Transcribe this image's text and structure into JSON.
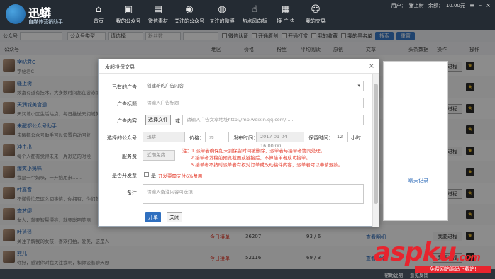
{
  "app": {
    "logo_name": "迅蟒",
    "logo_sub": "自媒体营销助手"
  },
  "nav": [
    {
      "label": "首页",
      "icon": "home-icon"
    },
    {
      "label": "我的公众号",
      "icon": "account-icon"
    },
    {
      "label": "微信素材",
      "icon": "folder-icon"
    },
    {
      "label": "关注的公众号",
      "icon": "wechat-icon"
    },
    {
      "label": "关注的微博",
      "icon": "weibo-icon"
    },
    {
      "label": "热点风向标",
      "icon": "thumbs-up-icon"
    },
    {
      "label": "接 广 告",
      "icon": "ad-icon"
    },
    {
      "label": "我的交易",
      "icon": "user-icon"
    }
  ],
  "userbar": {
    "user_label": "用户：",
    "user_name": "猪上树",
    "balance_label": "余额：",
    "balance": "10.00元"
  },
  "filter": {
    "account_label": "公众号",
    "type_select": "公众号类型",
    "region_select": "请选择",
    "fans_placeholder": "粉丝数",
    "opt_verified": "微信认证",
    "opt_original": "开通原创",
    "opt_reward": "开通打赏",
    "opt_mine": "我的收藏",
    "opt_ads": "我的黑名单",
    "search_btn": "搜索",
    "reset_btn": "重置"
  },
  "table": {
    "headers": [
      "公众号",
      "地区",
      "价格",
      "粉丝",
      "类别",
      "平均阅读",
      "原创",
      "文章",
      "头条数据",
      "操作",
      "聊天",
      "操作"
    ],
    "rows": [
      {
        "name": "字帖君C",
        "desc": "字帖君C",
        "today": "",
        "fans": "",
        "views": "",
        "detail": ""
      },
      {
        "name": "骚上树",
        "desc": "致富有道有技术，大多数时间都在游泳坑里玩",
        "today": "",
        "fans": "",
        "views": "",
        "detail": ""
      },
      {
        "name": "天润城美食通",
        "desc": "天润城小区生活站点，每日推送天润城美食",
        "today": "",
        "fans": "",
        "views": "",
        "detail": ""
      },
      {
        "name": "未醒都公众号助手",
        "desc": "未醒都公众号助手可以设置自动回复",
        "today": "",
        "fans": "",
        "views": "",
        "detail": ""
      },
      {
        "name": "冲击出",
        "desc": "每个人都有觉得未来一片渺茫的时候",
        "today": "",
        "fans": "",
        "views": "",
        "detail": ""
      },
      {
        "name": "爆笑小妈咪",
        "desc": "我是一个妈咪，一开始用来……",
        "today": "",
        "fans": "",
        "views": "",
        "detail": ""
      },
      {
        "name": "叶嘉音",
        "desc": "不懂得忙是这么回事情，你拥有，你们就……",
        "today": "",
        "fans": "",
        "views": "",
        "detail": ""
      },
      {
        "name": "查梦娜",
        "desc": "女人，就要智慧漂亮，就要聪明美丽",
        "today": "",
        "fans": "",
        "views": "",
        "detail": ""
      },
      {
        "name": "叶逍遥",
        "desc": "关注了解我的女孩，喜欢打拍，爱美，这是人的天性，你觉得呢？你愿意关注我吗？",
        "today": "今日接单",
        "fans": "36207",
        "views": "93 / 6",
        "detail": "查看明细"
      },
      {
        "name": "熊儿",
        "desc": "你好，感谢你对我关注我啊，和你谈着聊天思考过的，希望你都喜欢我，我也会，么么哒！",
        "today": "今日接单",
        "fans": "52116",
        "views": "69 / 3",
        "detail": "查看明细"
      }
    ],
    "progress_btn": "我要进程",
    "chat_btn": "聊天记录"
  },
  "dialog": {
    "title": "发起投保交易",
    "existing_ad_label": "已有的广告",
    "existing_ad_value": "创建新的广告内容",
    "ad_title_label": "广告标题",
    "ad_title_placeholder": "请输入广告标题",
    "ad_content_label": "广告内容",
    "choose_file": "选择文件",
    "or": "或",
    "url_placeholder": "请输入广告文章地址http://mp.weixin.qq.com/......",
    "chosen_account_label": "选择的公众号",
    "chosen_account": "迅蟒",
    "price_label": "价格：",
    "price_placeholder": "元",
    "publish_time_label": "发布时间：",
    "publish_time": "2017-01-04 16:00:00",
    "keep_time_label": "保留时间：",
    "keep_hours": "12",
    "hours_unit": "小时",
    "service_fee_label": "服务费",
    "service_fee": "近期免费",
    "note_title": "注：",
    "note_1": "1.派单者确保如未到保留时间被删除，派单者与接单者协同处理。",
    "note_2": "2.接单者发稿前预览截图或链接后，不算接单者成功接单。",
    "note_3": "3.接单者不按时派单者有权对订单或改动稿件内容，派单者可以申请退款。",
    "invoice_label": "是否开发票",
    "invoice_yes": "是",
    "invoice_tip": "开发票需支付6%费用",
    "remark_label": "备注",
    "remark_placeholder": "请输入备注内容可选填",
    "ok_btn": "开单",
    "cancel_btn": "关闭"
  },
  "footer": {
    "help": "帮助说明",
    "feedback": "意见反馈"
  },
  "watermark": {
    "main": "aspku",
    "dotcom": ".com",
    "sub": "免费网站源码下载站!"
  }
}
